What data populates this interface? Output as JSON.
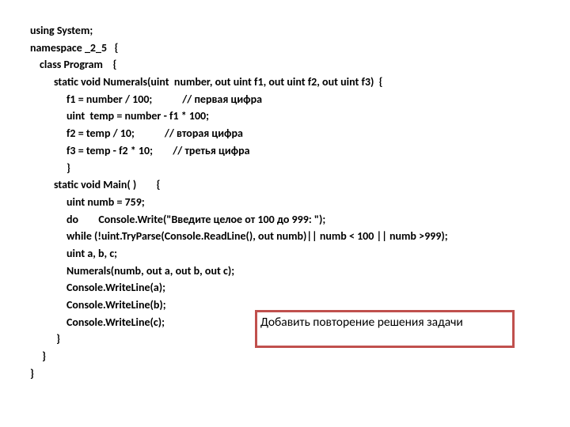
{
  "code": {
    "l1": "using System;",
    "l2": "namespace _2_5   {",
    "l3": "class Program    {",
    "l4": "static void Numerals(uint  number, out uint f1, out uint f2, out uint f3)  {",
    "l5": "f1 = number / 100;            // первая цифра",
    "l6": "uint  temp = number - f1 * 100;",
    "l7": "f2 = temp / 10;            // вторая цифра",
    "l8": "f3 = temp - f2 * 10;        // третья цифра",
    "l9": "}",
    "l10": "static void Main( )        {",
    "l11": "uint numb = 759;",
    "l12": "do        Console.Write(\"Введите целое от 100 до 999: \");",
    "l13": "while (!uint.TryParse(Console.ReadLine(), out numb)|| numb < 100 || numb >999);",
    "l14": "uint a, b, c;",
    "l15": "Numerals(numb, out a, out b, out c);",
    "l16": "Console.WriteLine(a);",
    "l17": "Console.WriteLine(b);",
    "l18": "Console.WriteLine(c);",
    "l19": " }",
    "l20": " }",
    "l21": "}"
  },
  "annotation": " Добавить повторение решения задачи"
}
